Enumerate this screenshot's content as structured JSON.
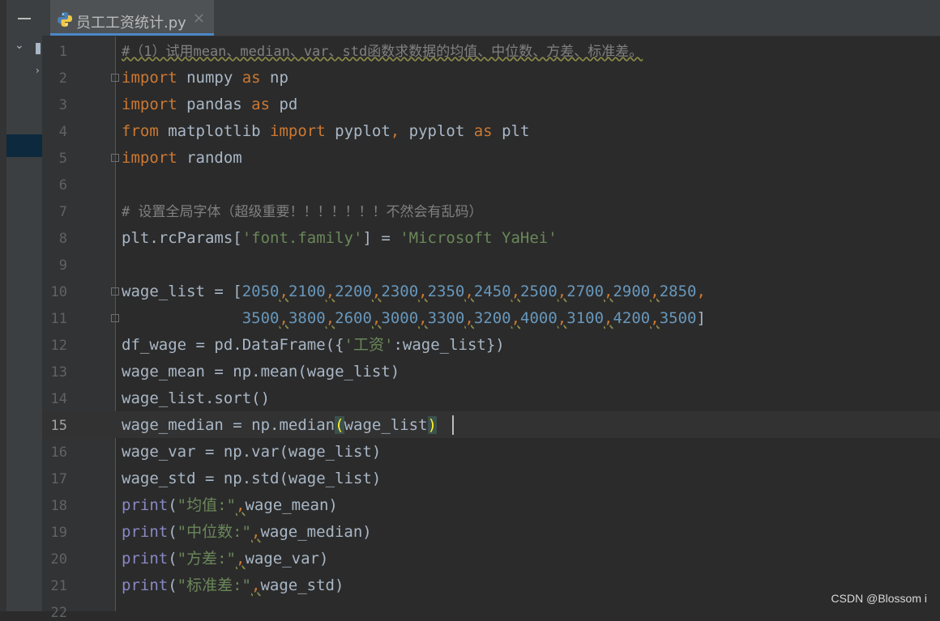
{
  "tab": {
    "filename": "员工工资统计.py",
    "close_glyph": "×",
    "icon": "python-file-icon"
  },
  "side": {
    "collapse_glyph": "—",
    "chevron_glyph": "⌄",
    "chevron2_glyph": "›"
  },
  "line_numbers": [
    "1",
    "2",
    "3",
    "4",
    "5",
    "6",
    "7",
    "8",
    "9",
    "10",
    "11",
    "12",
    "13",
    "14",
    "15",
    "16",
    "17",
    "18",
    "19",
    "20",
    "21",
    "22"
  ],
  "current_line": "15",
  "code": {
    "l1": "#（1）试用mean、median、var、std函数求数据的均值、中位数、方差、标准差。",
    "l2_kw": "import",
    "l2_mod": " numpy ",
    "l2_as": "as",
    "l2_alias": " np",
    "l3_kw": "import",
    "l3_mod": " pandas ",
    "l3_as": "as",
    "l3_alias": " pd",
    "l4_from": "from",
    "l4_mod": " matplotlib ",
    "l4_import": "import",
    "l4_names": " pyplot",
    "l4_comma": ",",
    "l4_names2": " pyplot ",
    "l4_as": "as",
    "l4_alias": " plt",
    "l5_kw": "import",
    "l5_mod": " random",
    "l7": "# 设置全局字体（超级重要！！！！！！！不然会有乱码）",
    "l8_a": "plt.rcParams[",
    "l8_key": "'font.family'",
    "l8_b": "] = ",
    "l8_val": "'Microsoft YaHei'",
    "l10_a": "wage_list = [",
    "l10_nums": [
      "2050",
      "2100",
      "2200",
      "2300",
      "2350",
      "2450",
      "2500",
      "2700",
      "2900",
      "2850"
    ],
    "l11_nums": [
      "3500",
      "3800",
      "2600",
      "3000",
      "3300",
      "3200",
      "4000",
      "3100",
      "4200",
      "3500"
    ],
    "l11_end": "]",
    "l12_a": "df_wage = pd.DataFrame({",
    "l12_key": "'工资'",
    "l12_b": ":wage_list})",
    "l13": "wage_mean = np.mean(wage_list)",
    "l14": "wage_list.sort()",
    "l15_a": "wage_median = np.median",
    "l15_open": "(",
    "l15_arg": "wage_list",
    "l15_close": ")",
    "l16": "wage_var = np.var(wage_list)",
    "l17": "wage_std = np.std(wage_list)",
    "l18_fn": "print",
    "l18_open": "(",
    "l18_str": "\"均值:\"",
    "l18_rest": "wage_mean)",
    "l19_fn": "print",
    "l19_open": "(",
    "l19_str": "\"中位数:\"",
    "l19_rest": "wage_median)",
    "l20_fn": "print",
    "l20_open": "(",
    "l20_str": "\"方差:\"",
    "l20_rest": "wage_var)",
    "l21_fn": "print",
    "l21_open": "(",
    "l21_str": "\"标准差:\"",
    "l21_rest": "wage_std)"
  },
  "watermark": "CSDN @Blossom i",
  "colors": {
    "keyword": "#cc7832",
    "string": "#6a8759",
    "number": "#6897bb",
    "comment": "#808080",
    "builtin": "#8888c6",
    "text": "#a9b7c6",
    "tab_underline": "#4a88c7"
  }
}
